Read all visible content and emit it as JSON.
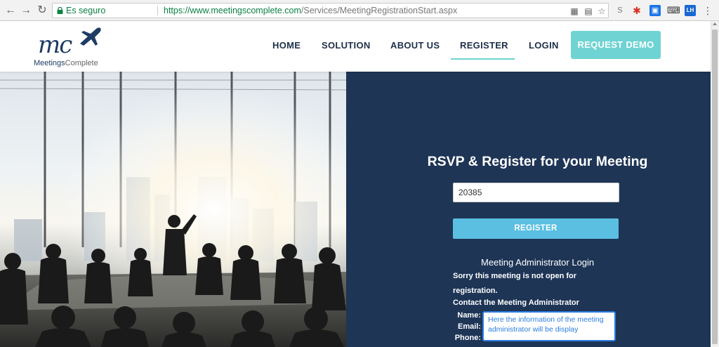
{
  "browser": {
    "back_icon": "back-arrow-icon",
    "forward_icon": "forward-arrow-icon",
    "reload_icon": "reload-icon",
    "secure_label": "Es seguro",
    "url_host": "https://www.meetingscomplete.com",
    "url_path": "/Services/MeetingRegistrationStart.aspx",
    "menu_icon": "more-vert-icon"
  },
  "logo": {
    "mark": "mc",
    "word_bold": "Meetings",
    "word_light": "Complete"
  },
  "nav": {
    "items": [
      "HOME",
      "SOLUTION",
      "ABOUT US",
      "REGISTER",
      "LOGIN"
    ],
    "active": "REGISTER",
    "demo_label": "REQUEST DEMO"
  },
  "form": {
    "title": "RSVP & Register for your Meeting",
    "code_value": "20385",
    "register_label": "REGISTER",
    "admin_login_label": "Meeting Administrator Login",
    "sorry_text": "Sorry this meeting is not open for registration.",
    "contact_heading": "Contact the Meeting Administrator",
    "name_label": "Name:",
    "email_label": "Email:",
    "phone_label": "Phone:",
    "tooltip": "Here the information of the meeting administrator will be display"
  },
  "colors": {
    "panel": "#1e3556",
    "accent": "#6fd3d3",
    "register_button": "#5bbfe2",
    "tooltip_border": "#2b7de0"
  }
}
